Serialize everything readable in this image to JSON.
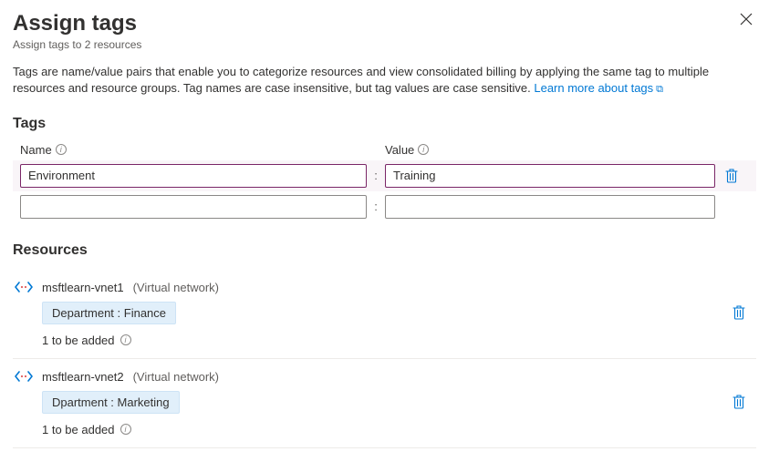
{
  "header": {
    "title": "Assign tags",
    "subtitle": "Assign tags to 2 resources"
  },
  "description": {
    "text": "Tags are name/value pairs that enable you to categorize resources and view consolidated billing by applying the same tag to multiple resources and resource groups. Tag names are case insensitive, but tag values are case sensitive.",
    "learnMore": "Learn more about tags"
  },
  "tagsSection": {
    "heading": "Tags",
    "nameLabel": "Name",
    "valueLabel": "Value",
    "rows": [
      {
        "name": "Environment",
        "value": "Training",
        "active": true,
        "deletable": true
      },
      {
        "name": "",
        "value": "",
        "active": false,
        "deletable": false
      }
    ]
  },
  "resourcesSection": {
    "heading": "Resources",
    "items": [
      {
        "name": "msftlearn-vnet1",
        "type": "(Virtual network)",
        "existingTag": "Department : Finance",
        "pending": "1 to be added"
      },
      {
        "name": "msftlearn-vnet2",
        "type": "(Virtual network)",
        "existingTag": "Dpartment : Marketing",
        "pending": "1 to be added"
      }
    ]
  }
}
